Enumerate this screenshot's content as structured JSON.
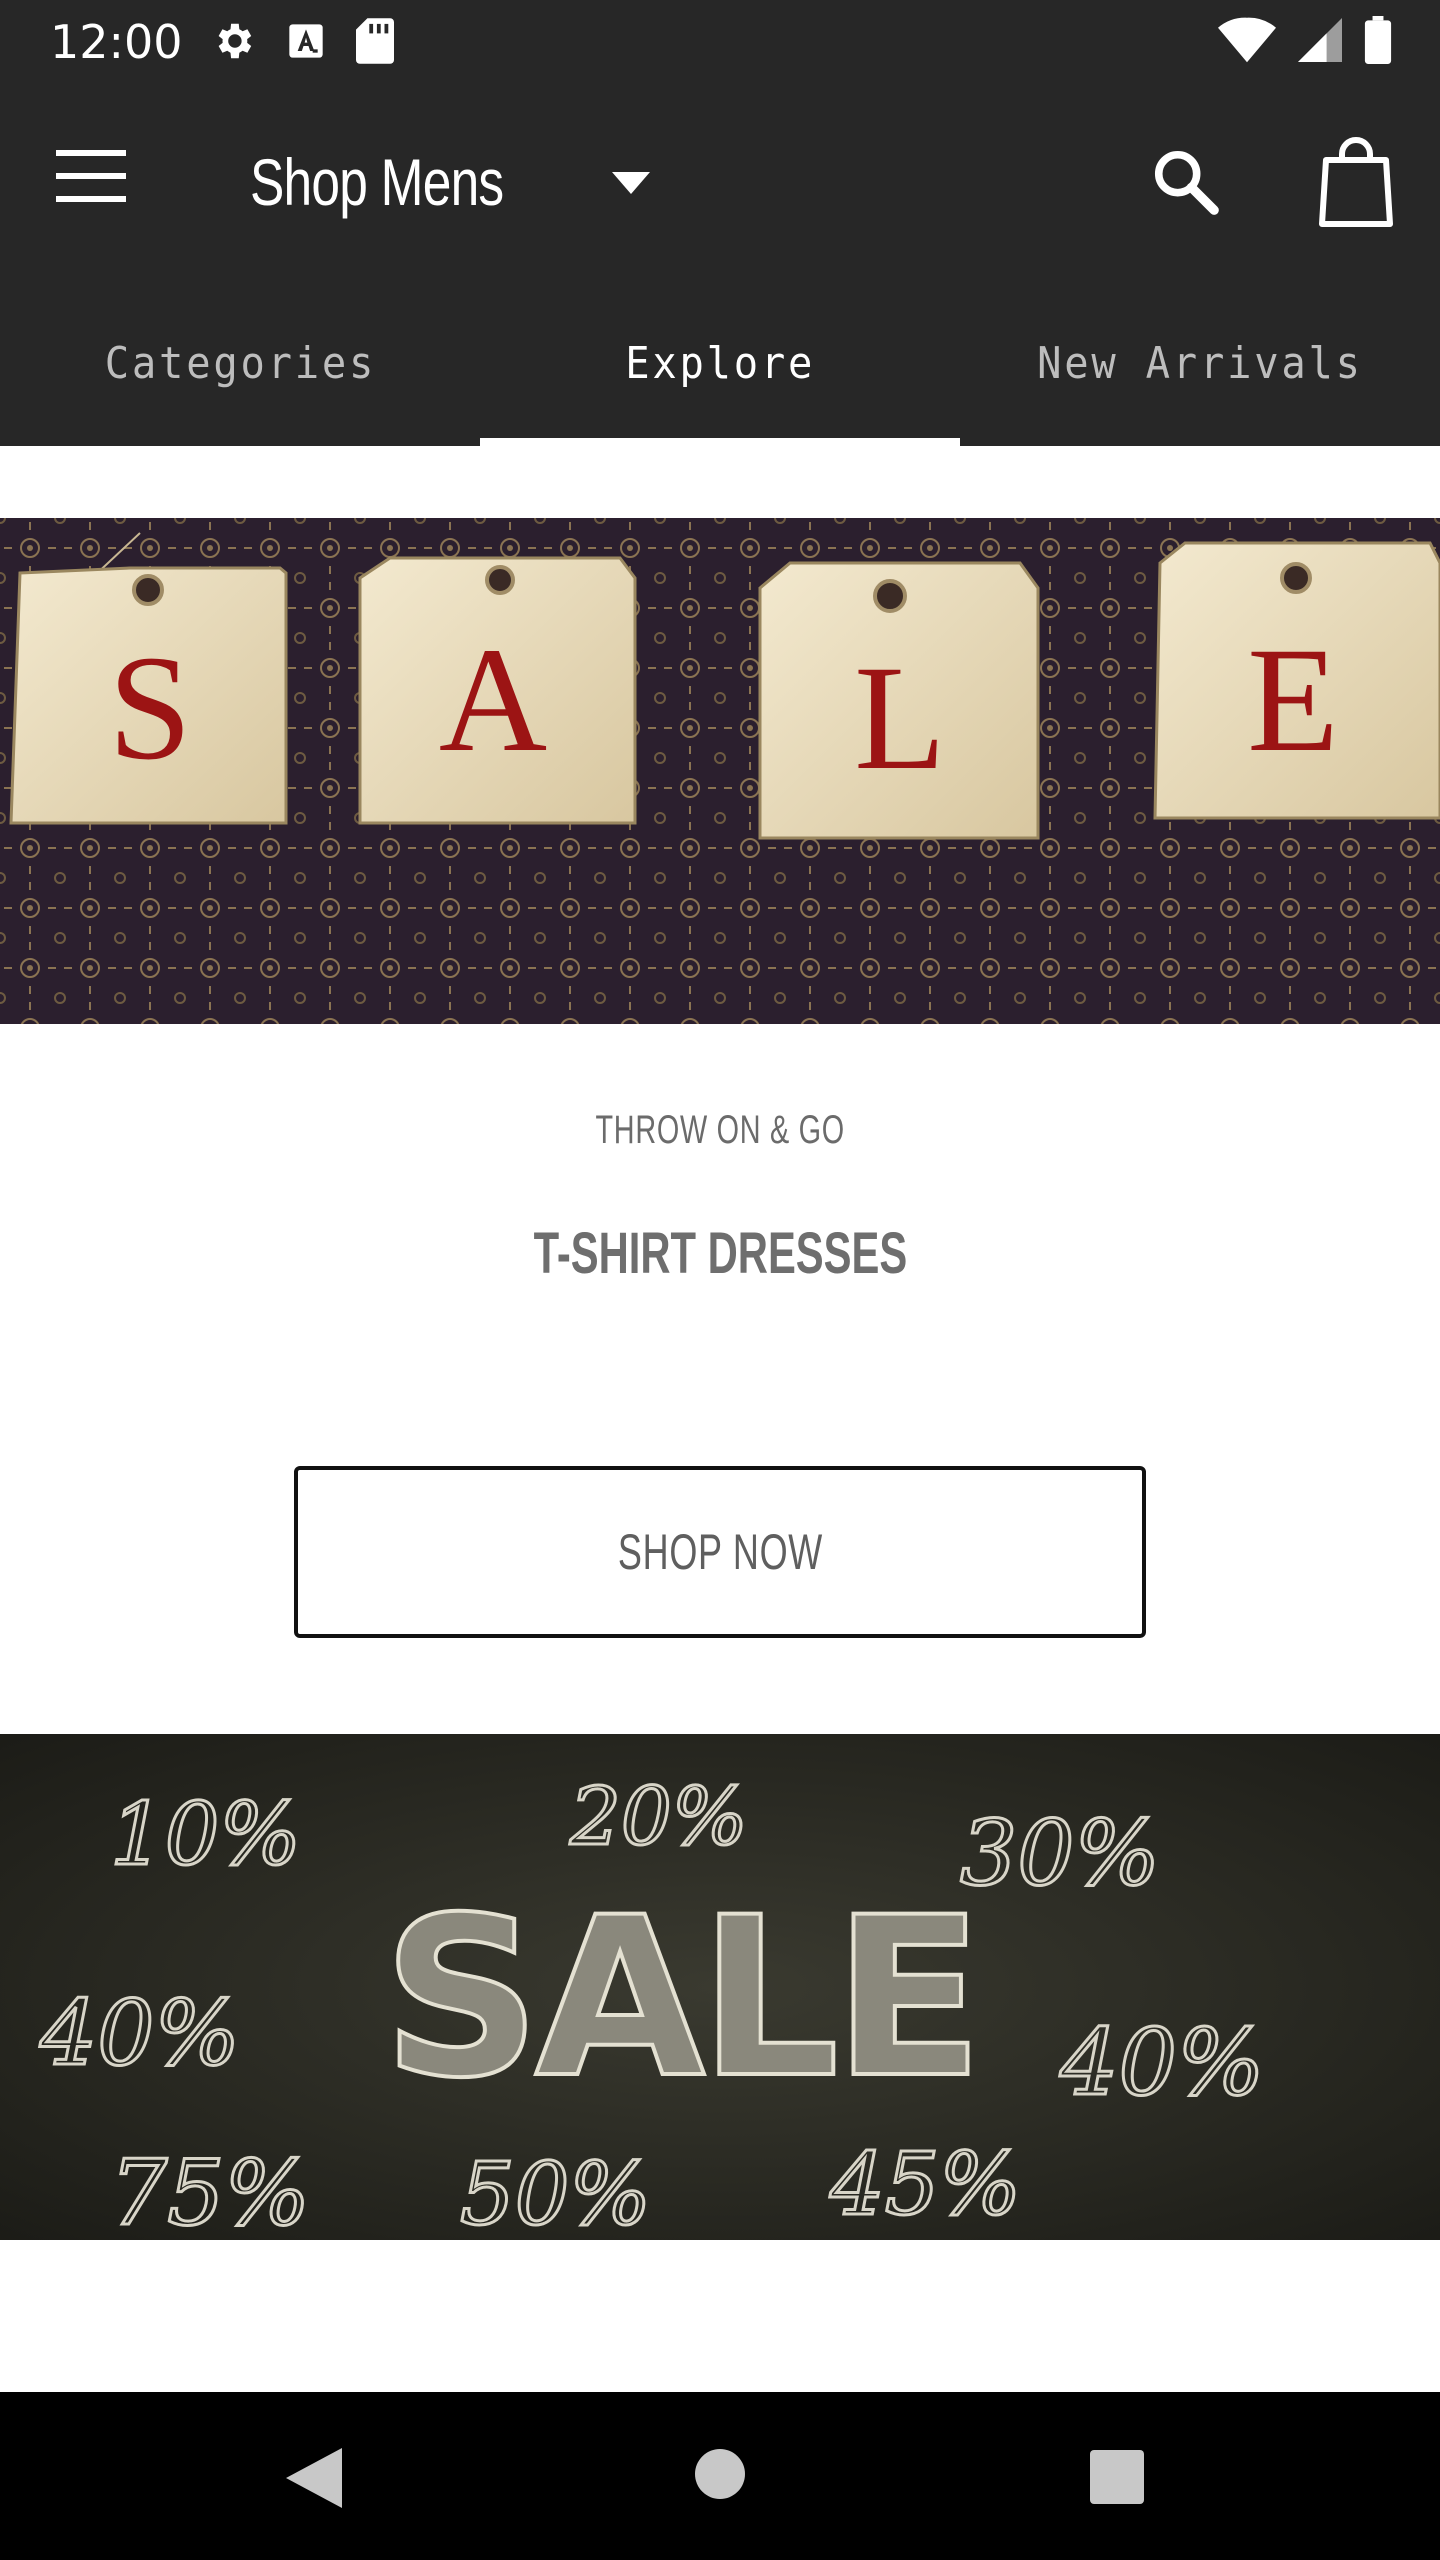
{
  "status_bar": {
    "time": "12:00",
    "icons_left": [
      "gear-icon",
      "text-a-icon",
      "sd-card-icon"
    ],
    "icons_right": [
      "wifi-icon",
      "cell-signal-icon",
      "battery-icon"
    ]
  },
  "app_bar": {
    "store_title": "Shop Mens",
    "icons": [
      "menu-icon",
      "dropdown-caret-icon",
      "search-icon",
      "shopping-bag-icon"
    ]
  },
  "tabs": [
    {
      "label": "Categories",
      "active": false
    },
    {
      "label": "Explore",
      "active": true
    },
    {
      "label": "New Arrivals",
      "active": false
    }
  ],
  "banner1": {
    "tags": [
      "S",
      "A",
      "L",
      "E"
    ]
  },
  "promo": {
    "kicker": "THROW ON & GO",
    "title": "T-SHIRT DRESSES",
    "button_label": "SHOP NOW"
  },
  "banner2": {
    "word": "SALE",
    "percent_marks": [
      "10%",
      "20%",
      "30%",
      "40%",
      "40%",
      "75%",
      "50%",
      "45%"
    ]
  },
  "nav_bar": {
    "icons": [
      "back-icon",
      "home-icon",
      "recents-icon"
    ]
  },
  "colors": {
    "app_bar": "#272727",
    "tag_letter": "#9c1414",
    "tag_paper": "#efe3c6",
    "chalkboard": "#2a2a22"
  }
}
